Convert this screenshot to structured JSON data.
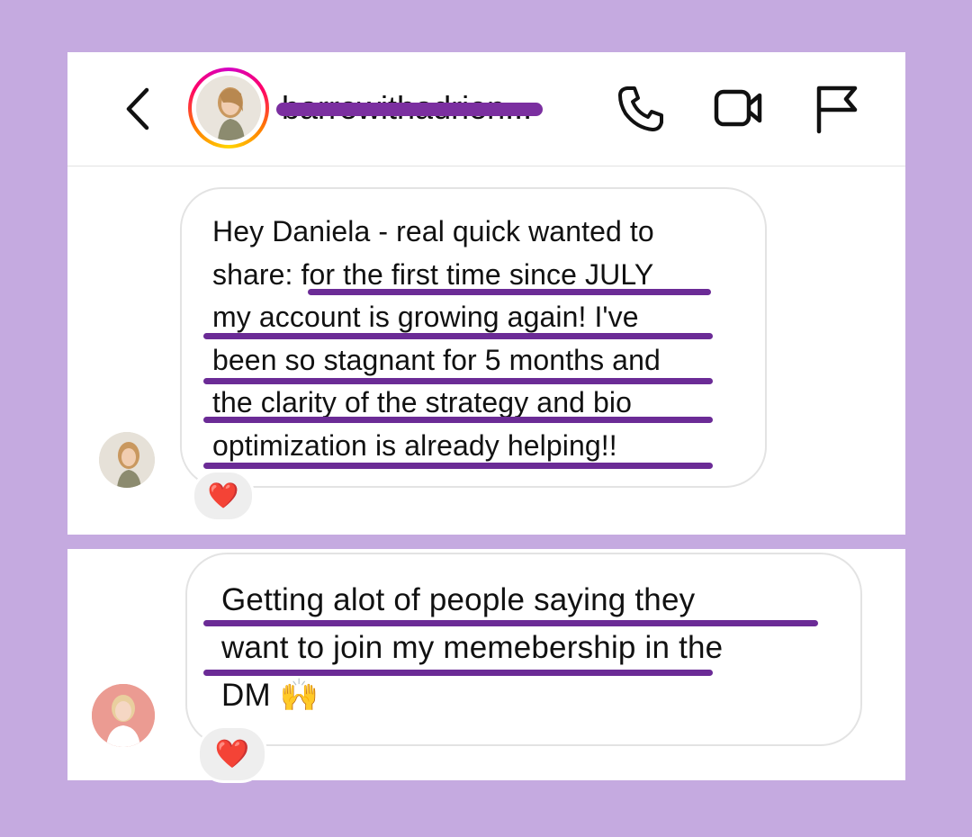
{
  "header": {
    "username": "barrewithadrien...",
    "back_icon": "chevron-left-icon",
    "call_icon": "phone-icon",
    "video_icon": "video-camera-icon",
    "report_icon": "flag-icon"
  },
  "colors": {
    "background": "#c5aae0",
    "highlight": "#6b2b96",
    "redaction": "#7b2fa0"
  },
  "messages": [
    {
      "lines": [
        "Hey Daniela - real quick wanted to",
        "share: for the first time since JULY",
        "my account is growing again! I've",
        "been so stagnant for 5 months and",
        "the clarity of the strategy and bio",
        "optimization is already helping!!"
      ],
      "reaction": "❤️"
    },
    {
      "lines": [
        "Getting alot of people saying they",
        "want to join my memebership in the",
        "DM 🙌"
      ],
      "reaction": "❤️"
    }
  ]
}
